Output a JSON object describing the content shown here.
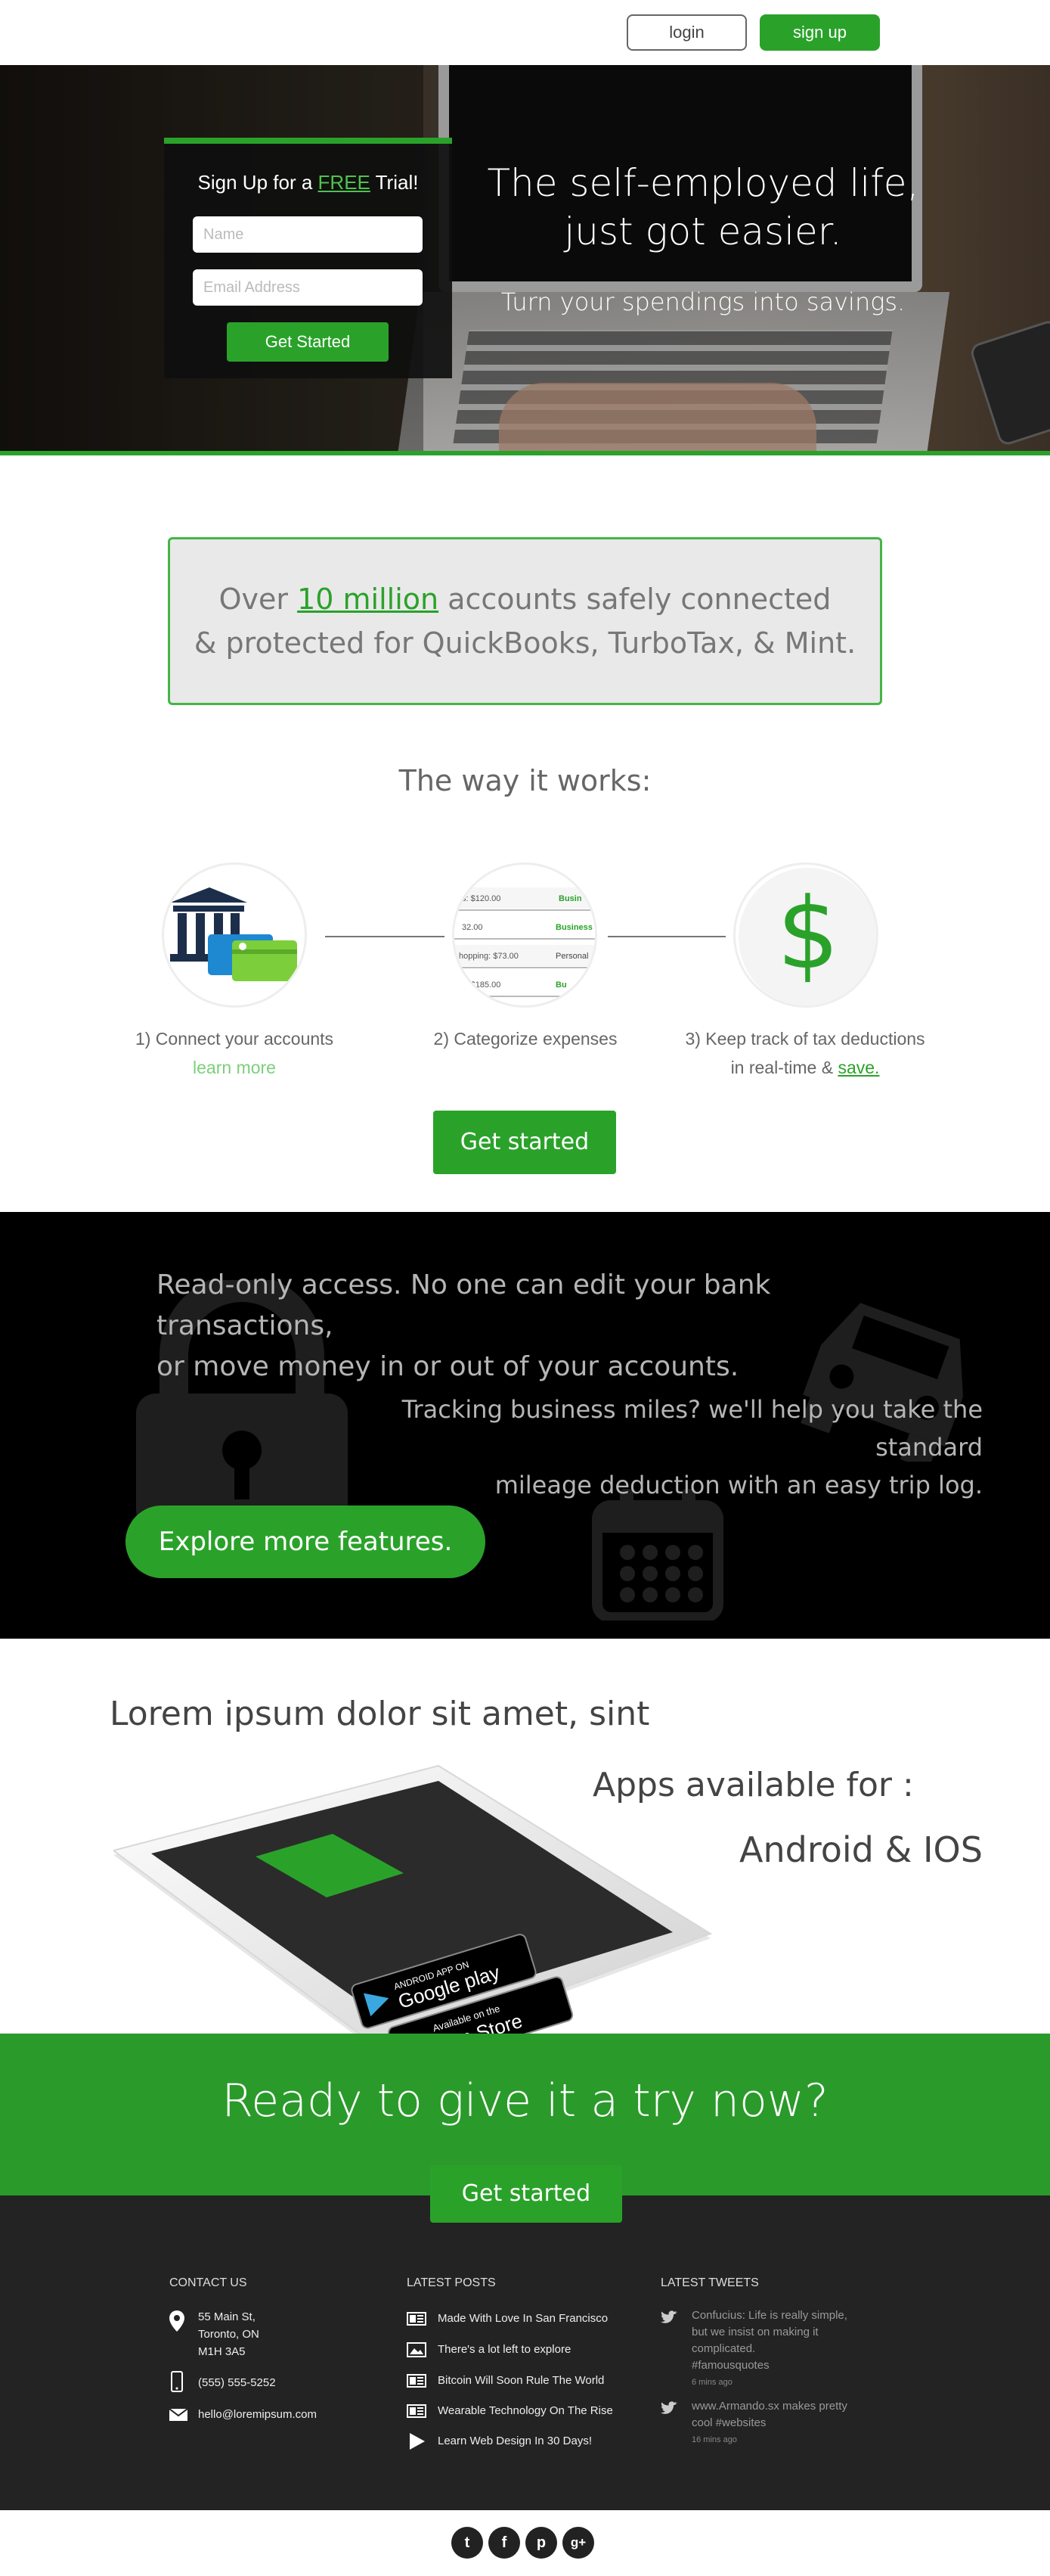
{
  "header": {
    "login_label": "login",
    "signup_label": "sign up"
  },
  "signup_form": {
    "title_pre": "Sign Up for a ",
    "title_free": "FREE",
    "title_post": " Trial!",
    "name_placeholder": "Name",
    "email_placeholder": "Email Address",
    "submit_label": "Get Started"
  },
  "hero": {
    "title_line1": "The self-employed life,",
    "title_line2": "just got easier.",
    "subtitle": "Turn your spendings into savings."
  },
  "stats": {
    "line1_pre": "Over ",
    "line1_highlight": "10 million",
    "line1_post": " accounts safely connected",
    "line2": "& protected for QuickBooks, TurboTax, & Mint."
  },
  "how": {
    "title": "The way it works:",
    "steps": [
      {
        "label": "1) Connect your accounts",
        "link": "learn more"
      },
      {
        "label": "2) Categorize expenses"
      },
      {
        "label_line1": "3) Keep track of tax deductions",
        "label_line2_pre": "in real-time & ",
        "label_line2_link": "save."
      }
    ],
    "expense_rows": [
      {
        "amount": "s: $120.00",
        "tag": "Busin"
      },
      {
        "amount": "32.00",
        "tag": "Business"
      },
      {
        "amount": "hopping: $73.00",
        "tag": "Personal"
      },
      {
        "amount": "s: $185.00",
        "tag": "Bu"
      }
    ],
    "dollar_symbol": "$",
    "cta_label": "Get started"
  },
  "features": {
    "security_line1": "Read-only access. No one can edit your bank transactions,",
    "security_line2": "or move money in or out of your accounts.",
    "mileage_line1": "Tracking business miles? we'll help you take the standard",
    "mileage_line2": "mileage deduction with an easy trip log.",
    "explore_label": "Explore more features."
  },
  "apps": {
    "heading": "Lorem ipsum dolor sit amet, sint",
    "available": "Apps available for :",
    "platforms": "Android & IOS",
    "google_small": "ANDROID APP ON",
    "google_big": "Google play",
    "apple_small": "Available on the",
    "apple_big": "App Store"
  },
  "cta": {
    "title": "Ready to give it a try now?",
    "button_label": "Get started"
  },
  "footer": {
    "contact_heading": "CONTACT US",
    "address_line1": "55 Main St,",
    "address_line2": "Toronto, ON",
    "address_line3": "M1H 3A5",
    "phone": "(555) 555-5252",
    "email": "hello@loremipsum.com",
    "posts_heading": "LATEST POSTS",
    "posts": [
      "Made With Love In San Francisco",
      "There's a lot left to explore",
      "Bitcoin Will Soon Rule The World",
      "Wearable Technology On The Rise",
      "Learn Web Design In 30 Days!"
    ],
    "tweets_heading": "LATEST TWEETS",
    "tweets": [
      {
        "line1": "Confucius: Life is really simple,",
        "line2": "but we insist on making it",
        "line3": "complicated.",
        "line4": "#famousquotes",
        "ago": "6 mins ago"
      },
      {
        "line1": "www.Armando.sx makes pretty",
        "line2": "cool #websites",
        "ago": "16 mins ago"
      }
    ]
  },
  "social": {
    "twitter": "t",
    "facebook": "f",
    "pinterest": "p",
    "googleplus": "g+"
  },
  "colors": {
    "brand_green": "#2aa22a",
    "dark_band": "#000000",
    "footer_bg": "#232323"
  }
}
